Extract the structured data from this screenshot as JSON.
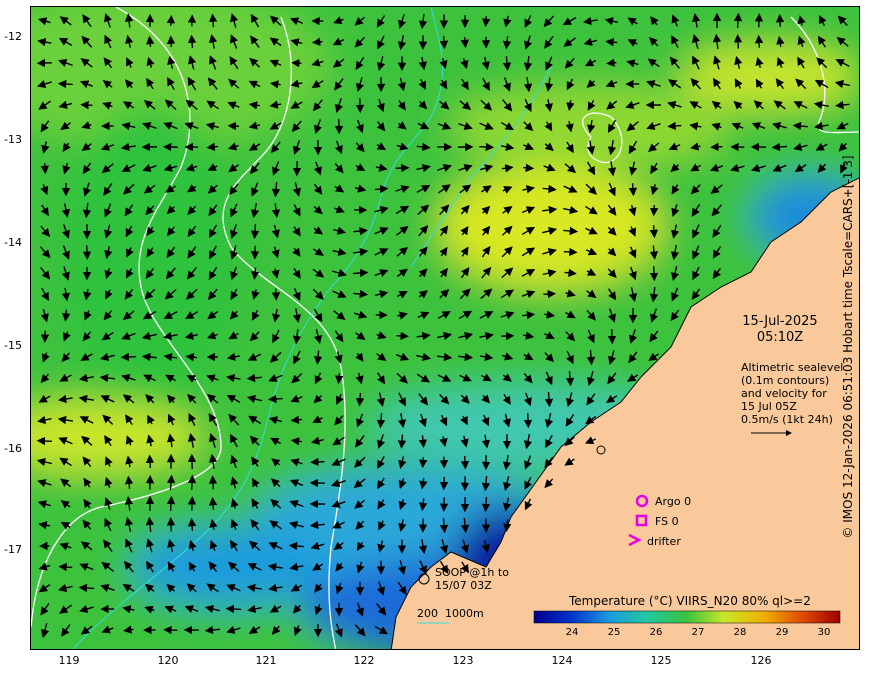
{
  "axes": {
    "lat_labels": [
      "-12",
      "-13",
      "-14",
      "-15",
      "-16",
      "-17"
    ],
    "lon_labels": [
      "119",
      "120",
      "121",
      "122",
      "123",
      "124",
      "125",
      "126"
    ]
  },
  "credit": "© IMOS 12-Jan-2026 06:51:03 Hobart time Tscale=CARS+[-1 3]",
  "overlay": {
    "date": "15-Jul-2025",
    "time": "05:10Z",
    "description_lines": [
      "Altimetric sealevel",
      "(0.1m contours)",
      "and velocity for",
      "15 Jul 05Z",
      "0.5m/s (1kt 24h)"
    ]
  },
  "legend": {
    "argo": "Argo 0",
    "fs": "FS 0",
    "drifter": "drifter",
    "soop_lines": [
      "SOOP @1h to",
      "15/07 03Z"
    ],
    "bathy": "200  1000m",
    "argo_color": "#e600e6",
    "bathy_color": "#33dddd"
  },
  "colorbar": {
    "title": "Temperature (°C) VIIRS_N20 80% ql>=2",
    "ticks": [
      "24",
      "25",
      "26",
      "27",
      "28",
      "29",
      "30"
    ]
  },
  "colors": {
    "land": "#f9c99c",
    "sea_green": "#3cc23c",
    "sea_yellow": "#c8e62a",
    "sea_blue": "#1e8cdc",
    "sea_deep": "#0a1aa0"
  }
}
